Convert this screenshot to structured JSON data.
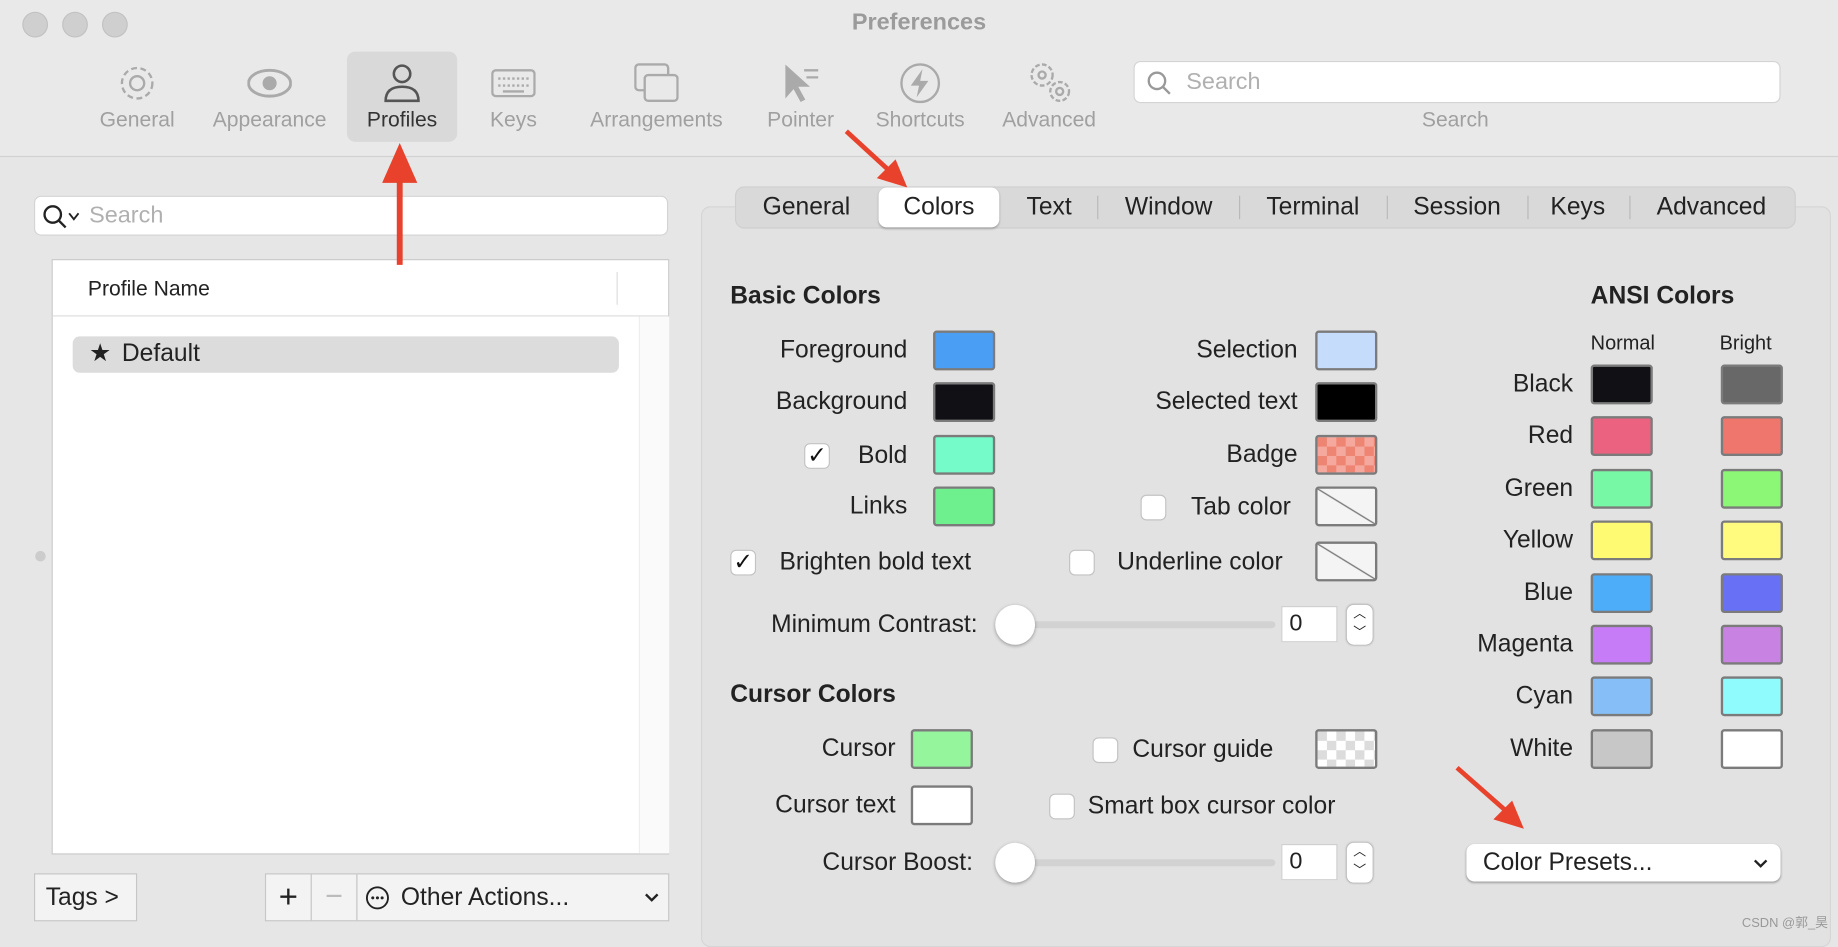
{
  "window": {
    "title": "Preferences"
  },
  "toolbar": {
    "items": [
      {
        "label": "General",
        "icon": "gear-icon"
      },
      {
        "label": "Appearance",
        "icon": "eye-icon"
      },
      {
        "label": "Profiles",
        "icon": "person-icon",
        "selected": true
      },
      {
        "label": "Keys",
        "icon": "keyboard-icon"
      },
      {
        "label": "Arrangements",
        "icon": "windows-icon"
      },
      {
        "label": "Pointer",
        "icon": "pointer-icon"
      },
      {
        "label": "Shortcuts",
        "icon": "lightning-icon"
      },
      {
        "label": "Advanced",
        "icon": "gears-icon"
      }
    ],
    "search_placeholder": "Search",
    "search_label": "Search"
  },
  "profiles": {
    "search_placeholder": "Search",
    "column_header": "Profile Name",
    "items": [
      {
        "name": "Default",
        "default": true
      }
    ],
    "tags_button": "Tags >",
    "add_button": "+",
    "remove_button": "−",
    "other_actions": "Other Actions..."
  },
  "tabs": [
    {
      "label": "General"
    },
    {
      "label": "Colors",
      "selected": true
    },
    {
      "label": "Text"
    },
    {
      "label": "Window"
    },
    {
      "label": "Terminal"
    },
    {
      "label": "Session"
    },
    {
      "label": "Keys"
    },
    {
      "label": "Advanced"
    }
  ],
  "basic_colors": {
    "heading": "Basic Colors",
    "foreground": {
      "label": "Foreground",
      "color": "#4a9ff5"
    },
    "background": {
      "label": "Background",
      "color": "#111115"
    },
    "bold": {
      "label": "Bold",
      "color": "#74fbc9",
      "checked": true
    },
    "links": {
      "label": "Links",
      "color": "#6ff08f"
    },
    "selection": {
      "label": "Selection",
      "color": "#c5dcfb"
    },
    "selected_text": {
      "label": "Selected text",
      "color": "#000000"
    },
    "badge": {
      "label": "Badge",
      "color": "#f08a7b"
    },
    "tab_color": {
      "label": "Tab color",
      "checked": false
    },
    "underline_color": {
      "label": "Underline color",
      "checked": false
    },
    "brighten_bold": {
      "label": "Brighten bold text",
      "checked": true
    },
    "min_contrast": {
      "label": "Minimum Contrast:",
      "value": "0"
    }
  },
  "cursor_colors": {
    "heading": "Cursor Colors",
    "cursor": {
      "label": "Cursor",
      "color": "#95f59c"
    },
    "cursor_text": {
      "label": "Cursor text",
      "color": "#ffffff"
    },
    "cursor_guide": {
      "label": "Cursor guide",
      "checked": false
    },
    "smart_box": {
      "label": "Smart box cursor color",
      "checked": false
    },
    "cursor_boost": {
      "label": "Cursor Boost:",
      "value": "0"
    }
  },
  "ansi": {
    "heading": "ANSI Colors",
    "normal_label": "Normal",
    "bright_label": "Bright",
    "rows": [
      {
        "name": "Black",
        "normal": "#111115",
        "bright": "#686868"
      },
      {
        "name": "Red",
        "normal": "#eb6281",
        "bright": "#ef766d"
      },
      {
        "name": "Green",
        "normal": "#77f8a5",
        "bright": "#8cf776"
      },
      {
        "name": "Yellow",
        "normal": "#fefb73",
        "bright": "#fefb7f"
      },
      {
        "name": "Blue",
        "normal": "#4eadf8",
        "bright": "#6871f6"
      },
      {
        "name": "Magenta",
        "normal": "#c67cf6",
        "bright": "#c882e2"
      },
      {
        "name": "Cyan",
        "normal": "#86bff7",
        "bright": "#8ffbfd"
      },
      {
        "name": "White",
        "normal": "#c7c7c7",
        "bright": "#ffffff"
      }
    ],
    "presets_button": "Color Presets..."
  },
  "annotation_color": "#e8412c",
  "watermark": "CSDN @郭_昊"
}
